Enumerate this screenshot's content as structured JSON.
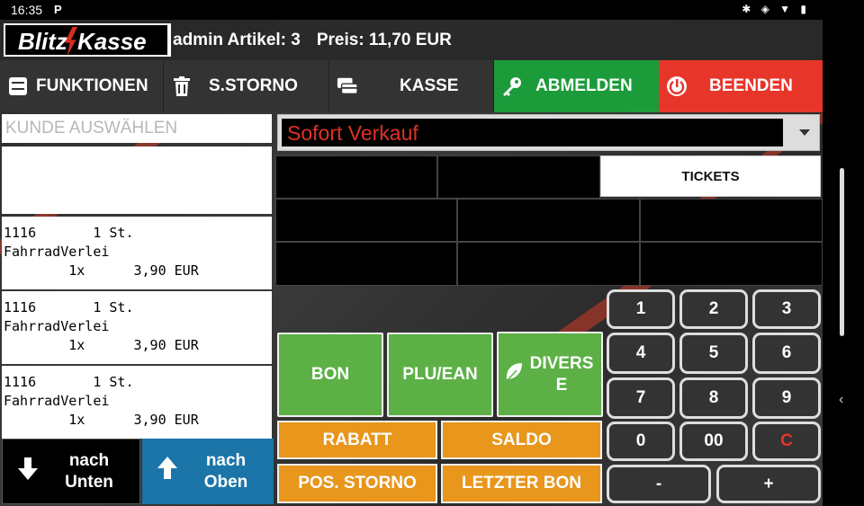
{
  "status_bar": {
    "time": "16:35",
    "notif": "P",
    "icons": "✱ ◈ ▼ ▮"
  },
  "logo": {
    "part1": "Blitz",
    "part2": "Kasse"
  },
  "header": {
    "user_articles": "admin Artikel: 3",
    "price": "Preis: 11,70 EUR"
  },
  "nav": {
    "funktionen": "FUNKTIONEN",
    "storno": "S.STORNO",
    "kasse": "KASSE",
    "abmelden": "ABMELDEN",
    "beenden": "BEENDEN"
  },
  "customer": {
    "placeholder": "KUNDE AUSWÄHLEN"
  },
  "sale_type": {
    "value": "Sofort Verkauf"
  },
  "receipt_items": [
    {
      "line1": "1116       1 St.",
      "line2": "FahrradVerlei",
      "line3": "        1x      3,90 EUR"
    },
    {
      "line1": "1116       1 St.",
      "line2": "FahrradVerlei",
      "line3": "        1x      3,90 EUR"
    },
    {
      "line1": "1116       1 St.",
      "line2": "FahrradVerlei",
      "line3": "        1x      3,90 EUR"
    }
  ],
  "scroll": {
    "down": "nach Unten",
    "up": "nach Oben"
  },
  "tickets_label": "TICKETS",
  "actions": {
    "bon": "BON",
    "plu": "PLU/EAN",
    "divers": "DIVERS E",
    "rabatt": "RABATT",
    "saldo": "SALDO",
    "pos_storno": "POS. STORNO",
    "letzter_bon": "LETZTER BON"
  },
  "keypad": {
    "k1": "1",
    "k2": "2",
    "k3": "3",
    "k4": "4",
    "k5": "5",
    "k6": "6",
    "k7": "7",
    "k8": "8",
    "k9": "9",
    "k0": "0",
    "k00": "00",
    "kc": "C",
    "minus": "-",
    "plus": "+"
  },
  "colors": {
    "green": "#1c9b3a",
    "red": "#e8352a",
    "blue": "#1b75a8",
    "orange": "#e8961c",
    "tile_green": "#5cb046"
  }
}
